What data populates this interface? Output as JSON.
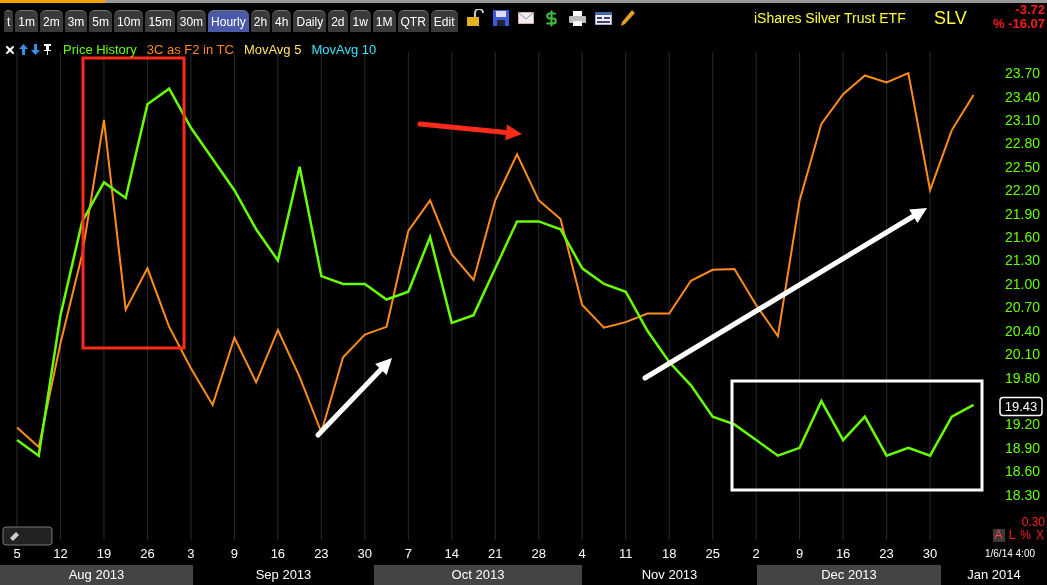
{
  "toolbar": {
    "tabs": [
      {
        "label": "t",
        "selected": false
      },
      {
        "label": "1m",
        "selected": false
      },
      {
        "label": "2m",
        "selected": false
      },
      {
        "label": "3m",
        "selected": false
      },
      {
        "label": "5m",
        "selected": false
      },
      {
        "label": "10m",
        "selected": false
      },
      {
        "label": "15m",
        "selected": false
      },
      {
        "label": "30m",
        "selected": false
      },
      {
        "label": "Hourly",
        "selected": true
      },
      {
        "label": "2h",
        "selected": false
      },
      {
        "label": "4h",
        "selected": false
      },
      {
        "label": "Daily",
        "selected": false
      },
      {
        "label": "2d",
        "selected": false
      },
      {
        "label": "1w",
        "selected": false
      },
      {
        "label": "1M",
        "selected": false
      },
      {
        "label": "QTR",
        "selected": false
      },
      {
        "label": "Edit",
        "selected": false
      }
    ]
  },
  "title": "iShares Silver Trust ETF",
  "symbol": "SLV",
  "change": "-3.72",
  "change_percent": "% -16.07",
  "legend_extra": [
    {
      "label": "MovAvg 5",
      "color": "#ffe066"
    },
    {
      "label": "MovAvg 10",
      "color": "#33e6ff"
    }
  ],
  "chart": {
    "chart_data": {
      "type": "line",
      "grid": true,
      "categories": [
        "5",
        null,
        "12",
        null,
        "19",
        null,
        "26",
        null,
        "3",
        null,
        "9",
        null,
        "16",
        null,
        "23",
        null,
        "30",
        null,
        "7",
        null,
        "14",
        null,
        "21",
        null,
        "28",
        null,
        "4",
        null,
        "11",
        null,
        "18",
        null,
        "25",
        null,
        "2",
        null,
        "9",
        null,
        "16",
        null,
        "23",
        null,
        "30",
        null,
        null
      ],
      "series": [
        {
          "name": "Price History",
          "color": "#66ff00",
          "values": [
            19.0,
            18.8,
            20.6,
            21.8,
            22.3,
            22.1,
            23.3,
            23.5,
            23.0,
            22.6,
            22.2,
            21.7,
            21.3,
            22.5,
            21.1,
            21.0,
            21.0,
            20.8,
            20.9,
            21.6,
            20.5,
            20.6,
            21.2,
            21.8,
            21.8,
            21.7,
            21.2,
            21.0,
            20.9,
            20.4,
            20.0,
            19.7,
            19.3,
            19.2,
            19.0,
            18.8,
            18.9,
            19.5,
            19.0,
            19.3,
            18.8,
            18.9,
            18.8,
            19.3,
            19.45
          ]
        },
        {
          "name": "3C as F2 in TC",
          "color": "#ff8c1a",
          "values": [
            19.16,
            18.91,
            20.24,
            21.38,
            23.1,
            20.67,
            21.2,
            20.45,
            19.92,
            19.45,
            20.31,
            19.74,
            20.41,
            19.81,
            19.1,
            20.06,
            20.35,
            20.45,
            21.68,
            22.07,
            21.38,
            21.05,
            22.07,
            22.66,
            22.07,
            21.83,
            20.73,
            20.44,
            20.51,
            20.62,
            20.62,
            21.04,
            21.18,
            21.19,
            20.73,
            20.33,
            22.07,
            23.05,
            23.43,
            23.67,
            23.58,
            23.7,
            22.2,
            22.97,
            23.42
          ]
        }
      ],
      "ylim": [
        17.72,
        23.97
      ],
      "yticks": [
        {
          "value": 23.7,
          "label": "23.70"
        },
        {
          "value": 23.4,
          "label": "23.40"
        },
        {
          "value": 23.1,
          "label": "23.10"
        },
        {
          "value": 22.8,
          "label": "22.80"
        },
        {
          "value": 22.5,
          "label": "22.50"
        },
        {
          "value": 22.2,
          "label": "22.20"
        },
        {
          "value": 21.9,
          "label": "21.90"
        },
        {
          "value": 21.6,
          "label": "21.60"
        },
        {
          "value": 21.3,
          "label": "21.30"
        },
        {
          "value": 21.0,
          "label": "21.00"
        },
        {
          "value": 20.7,
          "label": "20.70"
        },
        {
          "value": 20.4,
          "label": "20.40"
        },
        {
          "value": 20.1,
          "label": "20.10"
        },
        {
          "value": 19.8,
          "label": "19.80"
        },
        {
          "value": 19.2,
          "label": "19.20"
        },
        {
          "value": 18.9,
          "label": "18.90"
        },
        {
          "value": 18.6,
          "label": "18.60"
        },
        {
          "value": 18.3,
          "label": "18.30"
        }
      ]
    },
    "last_price": "19.43",
    "scale": "0.30",
    "scale_buttons": [
      {
        "label": "A",
        "selected": true
      },
      {
        "label": "L",
        "selected": false
      },
      {
        "label": "%",
        "selected": false
      },
      {
        "label": "X",
        "selected": false
      }
    ],
    "timestamp": "1/6/14 4:00",
    "months": [
      {
        "label": "Aug 2013",
        "shaded": true
      },
      {
        "label": "Sep 2013",
        "shaded": false
      },
      {
        "label": "Oct 2013",
        "shaded": true
      },
      {
        "label": "Nov 2013",
        "shaded": false
      },
      {
        "label": "Dec 2013",
        "shaded": true
      },
      {
        "label": "Jan 2014",
        "shaded": false
      }
    ]
  }
}
